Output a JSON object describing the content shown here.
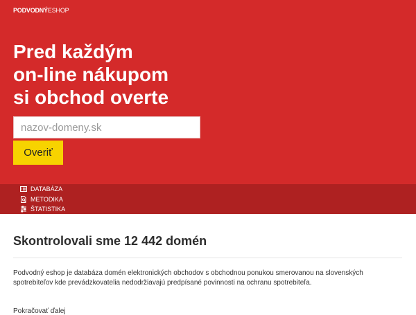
{
  "header": {
    "logo_bold": "PODVODNÝ",
    "logo_light": "ESHOP"
  },
  "hero": {
    "headline": "Pred každým\non-line nákupom\nsi obchod overte",
    "search_placeholder": "nazov-domeny.sk",
    "search_value": "",
    "verify_label": "Overiť"
  },
  "nav": {
    "items": [
      {
        "label": "DATABÁZA",
        "icon": "list-icon"
      },
      {
        "label": "METODIKA",
        "icon": "document-search-icon"
      },
      {
        "label": "ŠTATISTIKA",
        "icon": "stats-icon"
      }
    ]
  },
  "main": {
    "title": "Skontrolovali sme 12 442 domén",
    "description": "Podvodný eshop je databáza domén elektronických obchodov s obchodnou ponukou smerovanou na slovenských spotrebiteľov kde prevádzkovatelia nedodržiavajú predpísané povinnosti na ochranu spotrebiteľa.",
    "cut_text": "Pokračovať ďalej"
  },
  "colors": {
    "hero_bg": "#d42a2a",
    "nav_bg": "#ae2121",
    "accent_button": "#f7d300"
  }
}
